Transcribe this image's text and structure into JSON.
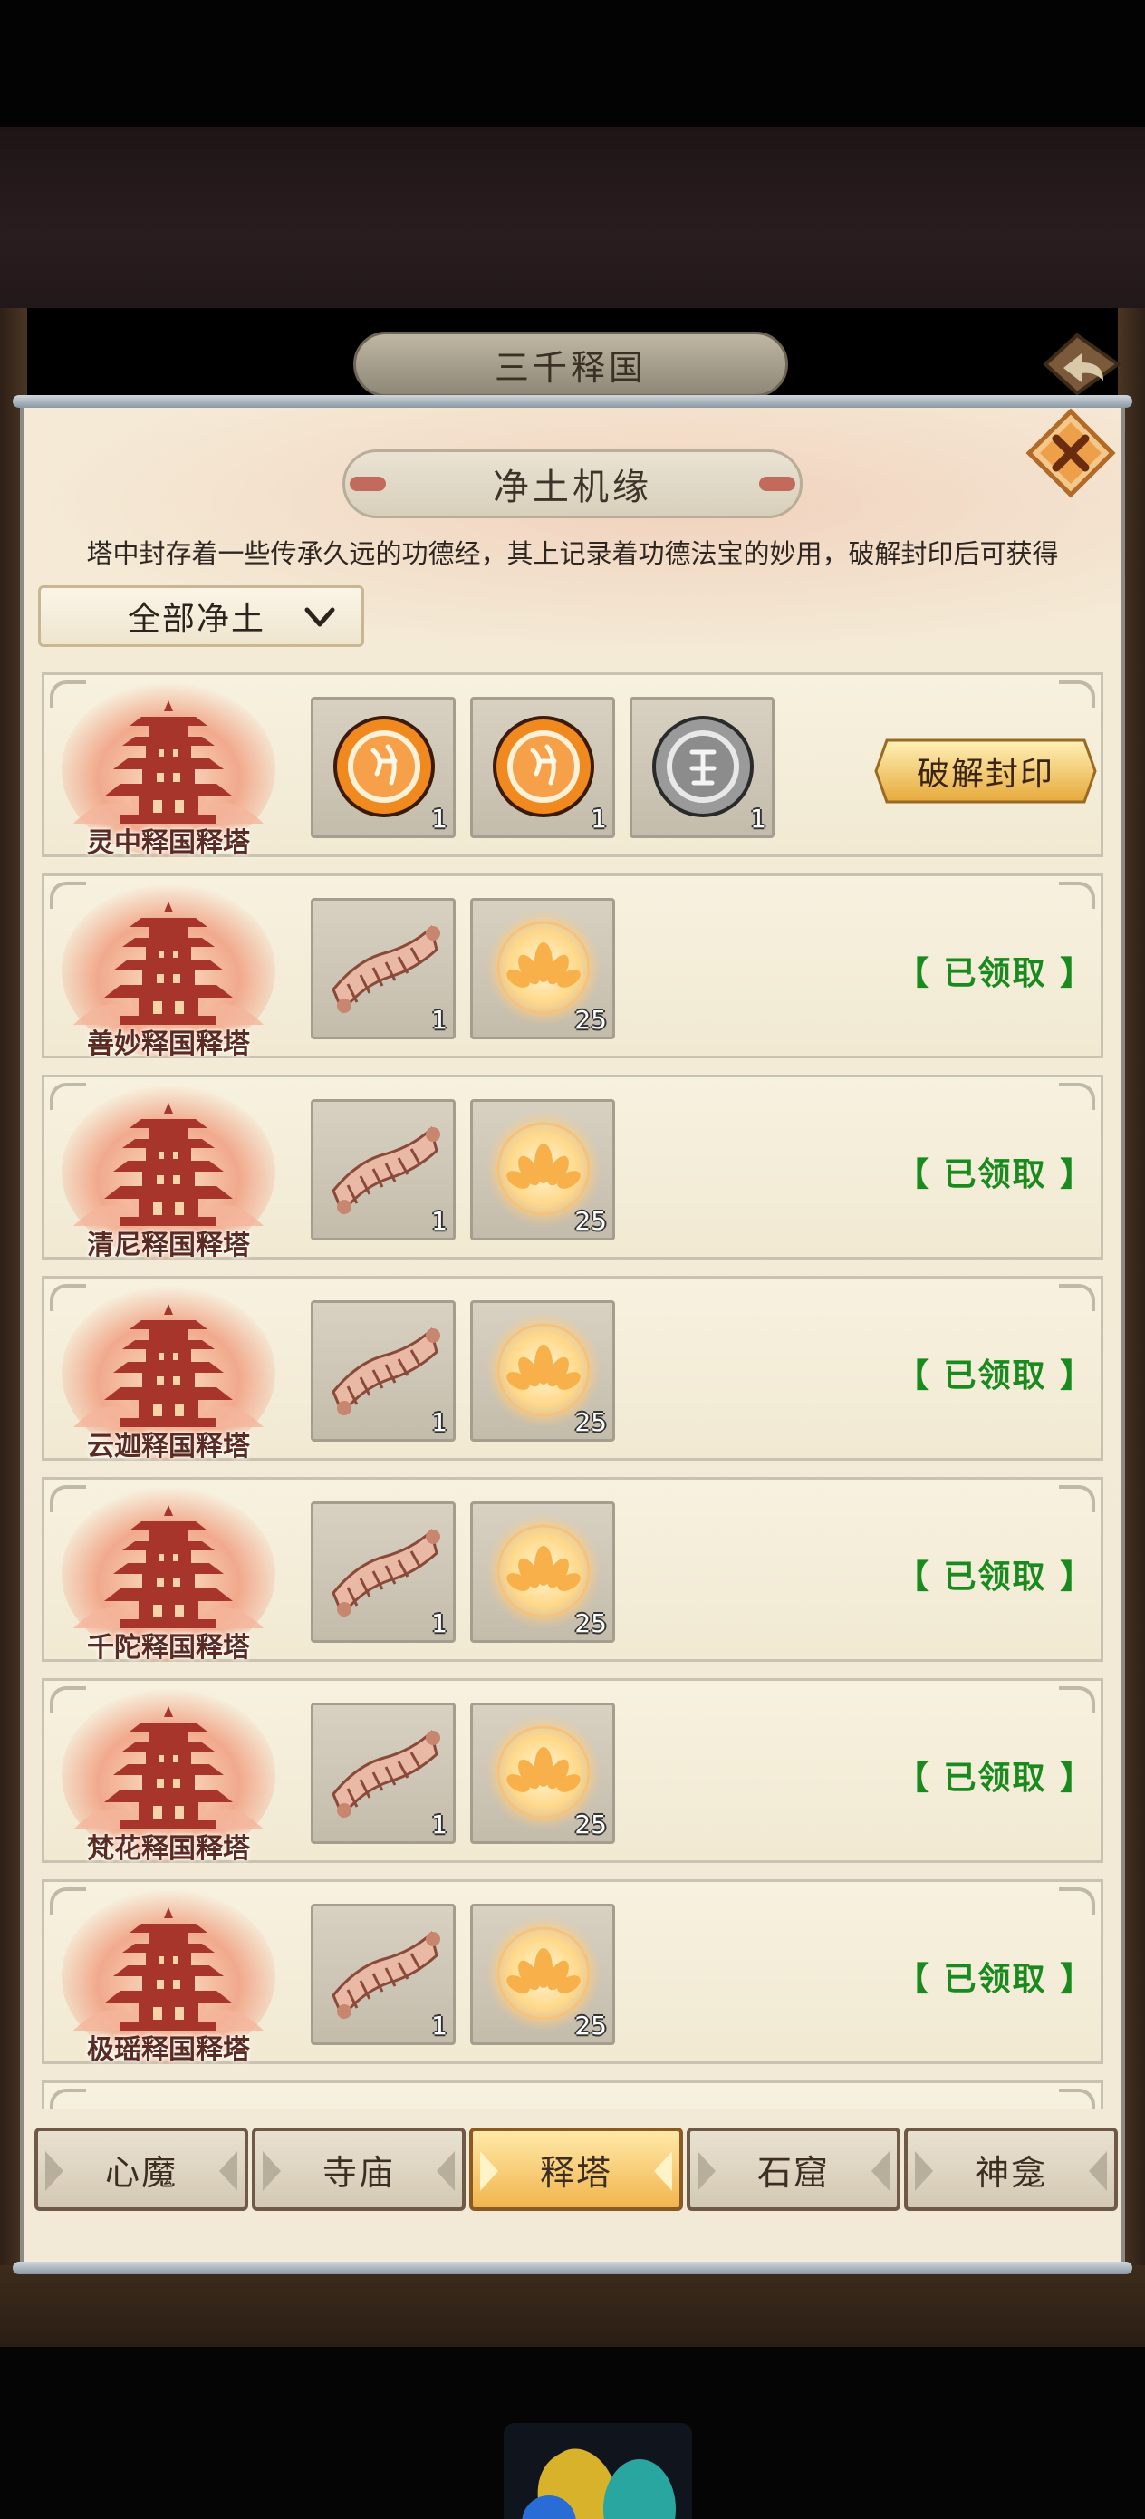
{
  "header": {
    "title": "三千释国"
  },
  "panel": {
    "title": "净土机缘",
    "description": "塔中封存着一些传承久远的功德经，其上记录着功德法宝的妙用，破解封印后可获得",
    "filter": {
      "selected": "全部净土"
    }
  },
  "rows": [
    {
      "name": "灵中释国释塔",
      "rewards": [
        {
          "icon": "orange-rune-medallion",
          "qty": "1"
        },
        {
          "icon": "orange-rune-medallion",
          "qty": "1"
        },
        {
          "icon": "silver-rune-medallion",
          "qty": "1"
        }
      ],
      "action": "破解封印",
      "status": ""
    },
    {
      "name": "善妙释国释塔",
      "rewards": [
        {
          "icon": "scroll-slips",
          "qty": "1"
        },
        {
          "icon": "lotus-orb",
          "qty": "25"
        }
      ],
      "action": "",
      "status": "【 已领取 】"
    },
    {
      "name": "清尼释国释塔",
      "rewards": [
        {
          "icon": "scroll-slips",
          "qty": "1"
        },
        {
          "icon": "lotus-orb",
          "qty": "25"
        }
      ],
      "action": "",
      "status": "【 已领取 】"
    },
    {
      "name": "云迦释国释塔",
      "rewards": [
        {
          "icon": "scroll-slips",
          "qty": "1"
        },
        {
          "icon": "lotus-orb",
          "qty": "25"
        }
      ],
      "action": "",
      "status": "【 已领取 】"
    },
    {
      "name": "千陀释国释塔",
      "rewards": [
        {
          "icon": "scroll-slips",
          "qty": "1"
        },
        {
          "icon": "lotus-orb",
          "qty": "25"
        }
      ],
      "action": "",
      "status": "【 已领取 】"
    },
    {
      "name": "梵花释国释塔",
      "rewards": [
        {
          "icon": "scroll-slips",
          "qty": "1"
        },
        {
          "icon": "lotus-orb",
          "qty": "25"
        }
      ],
      "action": "",
      "status": "【 已领取 】"
    },
    {
      "name": "极瑶释国释塔",
      "rewards": [
        {
          "icon": "scroll-slips",
          "qty": "1"
        },
        {
          "icon": "lotus-orb",
          "qty": "25"
        }
      ],
      "action": "",
      "status": "【 已领取 】"
    }
  ],
  "tabs": [
    {
      "label": "心魔",
      "active": false
    },
    {
      "label": "寺庙",
      "active": false
    },
    {
      "label": "释塔",
      "active": true
    },
    {
      "label": "石窟",
      "active": false
    },
    {
      "label": "神龛",
      "active": false
    }
  ],
  "colors": {
    "claimed": "#198a1e",
    "tower_name": "#5a2b22",
    "active_tab": "#f2b54e"
  }
}
